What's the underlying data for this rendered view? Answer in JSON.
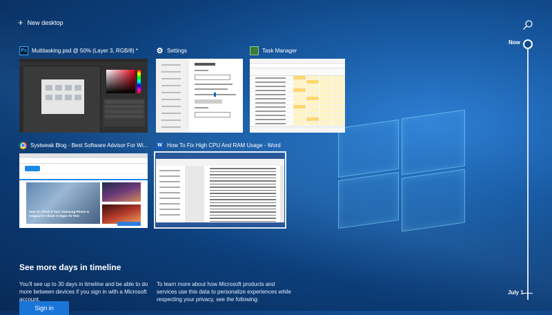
{
  "header": {
    "new_desktop_label": "New desktop",
    "new_desktop_icon": "plus-icon",
    "search_icon": "search-icon"
  },
  "timeline": {
    "now_label": "Now",
    "date_label": "July 1"
  },
  "windows": [
    {
      "title": "Multitasking.psd @ 50% (Layer 3, RGB/8) *",
      "app": "Photoshop",
      "icon": "photoshop-icon",
      "icon_text": "Ps"
    },
    {
      "title": "Settings",
      "app": "Settings",
      "icon": "gear-icon",
      "icon_text": "⚙"
    },
    {
      "title": "Task Manager",
      "app": "Task Manager",
      "icon": "task-manager-icon",
      "icon_text": ""
    },
    {
      "title": "Systweak Blog - Best Software Advisor For Wi...",
      "app": "Chrome",
      "icon": "chrome-icon",
      "icon_text": ""
    },
    {
      "title": "How To Fix High CPU And RAM Usage - Word",
      "app": "Word",
      "icon": "word-icon",
      "icon_text": "W"
    }
  ],
  "blog_preview": {
    "hero_text": "How To Check If Your Samsung Phone Is Original Or Clone: 8 Signs To Test",
    "side_text_1": "",
    "side_text_2": ""
  },
  "promo": {
    "title": "See more days in timeline",
    "description": "You'll see up to 30 days in timeline and be able to do more between devices if you sign in with a Microsoft account.",
    "learn_more": "To learn more about how Microsoft products and services use this data to personalize experiences while respecting your privacy, see the following:",
    "sign_in_label": "Sign in"
  },
  "colors": {
    "accent": "#1a75d8",
    "background": "#0c3e7a"
  }
}
